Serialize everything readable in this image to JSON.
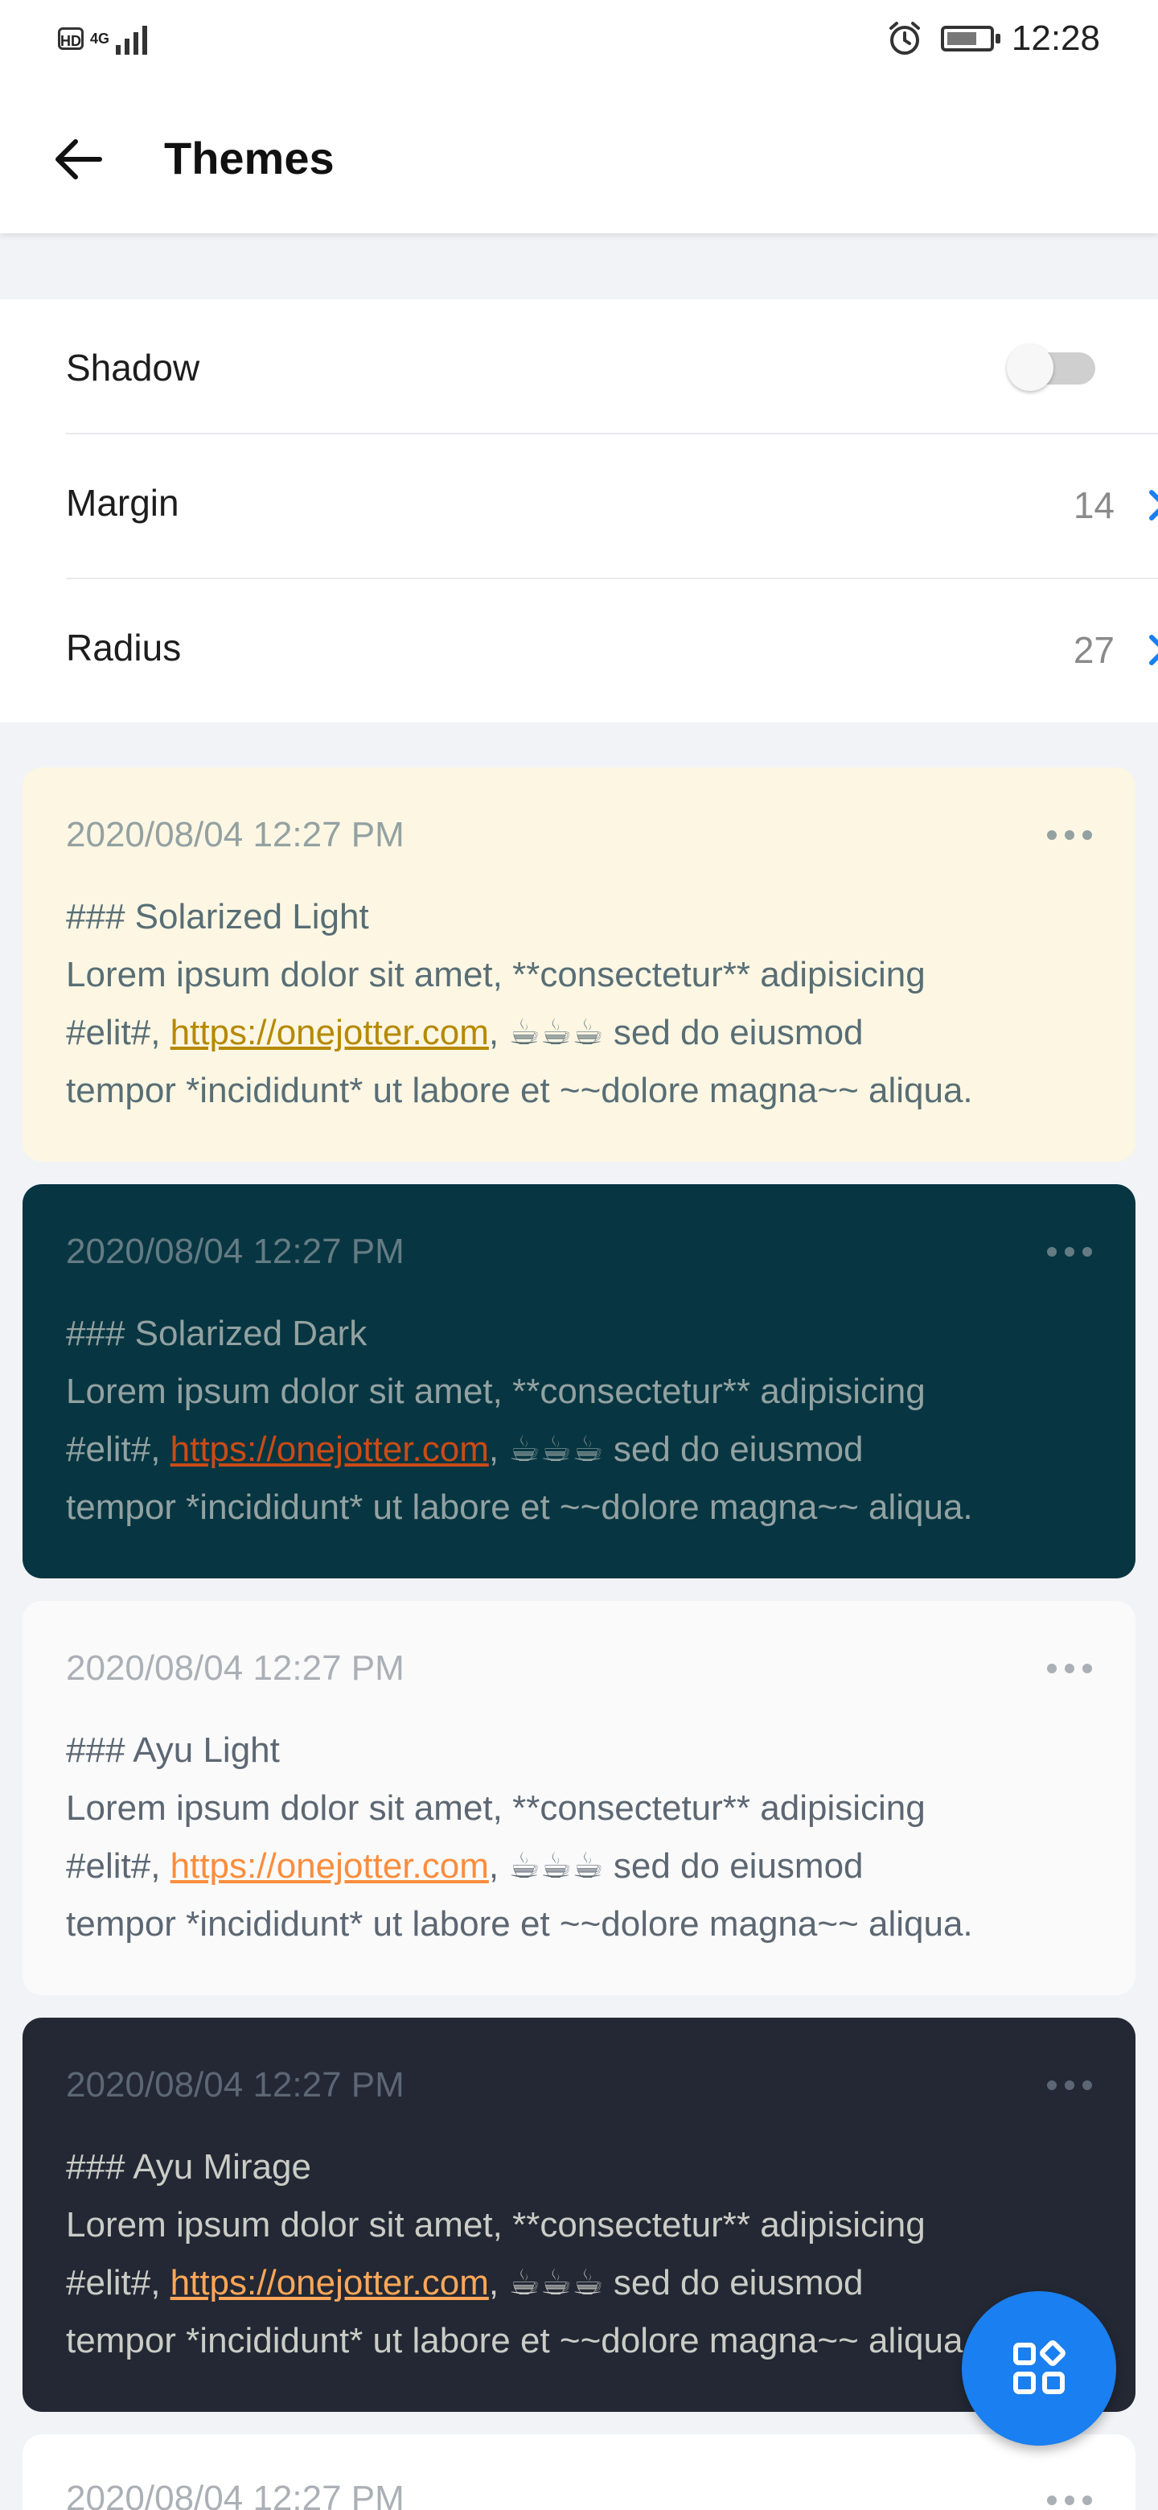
{
  "status_bar": {
    "hd": "HD",
    "network": "4G",
    "time": "12:28"
  },
  "app_bar": {
    "title": "Themes"
  },
  "settings": {
    "shadow": {
      "label": "Shadow",
      "enabled": false
    },
    "margin": {
      "label": "Margin",
      "value": "14"
    },
    "radius": {
      "label": "Radius",
      "value": "27"
    }
  },
  "cards": [
    {
      "date": "2020/08/04 12:27 PM",
      "heading": "### Solarized Light",
      "line1": "Lorem ipsum dolor sit amet, **consectetur** adipisicing",
      "line2_prefix": "#elit#, ",
      "link": "https://onejotter.com",
      "line2_mid": ", ",
      "cups": "☕☕☕",
      "line2_suffix": " sed do eiusmod",
      "line3": "tempor *incididunt* ut labore et ~~dolore magna~~ aliqua.",
      "colors": {
        "bg": "#fdf6e3",
        "text": "#586e75",
        "date": "#93a1a1",
        "link": "#b58900"
      }
    },
    {
      "date": "2020/08/04 12:27 PM",
      "heading": "### Solarized Dark",
      "line1": "Lorem ipsum dolor sit amet, **consectetur** adipisicing",
      "line2_prefix": "#elit#, ",
      "link": "https://onejotter.com",
      "line2_mid": ", ",
      "cups": "☕☕☕",
      "line2_suffix": " sed do eiusmod",
      "line3": "tempor *incididunt* ut labore et ~~dolore magna~~ aliqua.",
      "colors": {
        "bg": "#073642",
        "text": "#93a1a1",
        "date": "#657b83",
        "link": "#cb4b16"
      }
    },
    {
      "date": "2020/08/04 12:27 PM",
      "heading": "### Ayu Light",
      "line1": "Lorem ipsum dolor sit amet, **consectetur** adipisicing",
      "line2_prefix": "#elit#, ",
      "link": "https://onejotter.com",
      "line2_mid": ", ",
      "cups": "☕☕☕",
      "line2_suffix": " sed do eiusmod",
      "line3": "tempor *incididunt* ut labore et ~~dolore magna~~ aliqua.",
      "colors": {
        "bg": "#fafafa",
        "text": "#5c6773",
        "date": "#abb0b6",
        "link": "#fa8d3e"
      }
    },
    {
      "date": "2020/08/04 12:27 PM",
      "heading": "### Ayu Mirage",
      "line1": "Lorem ipsum dolor sit amet, **consectetur** adipisicing",
      "line2_prefix": "#elit#, ",
      "link": "https://onejotter.com",
      "line2_mid": ", ",
      "cups": "☕☕☕",
      "line2_suffix": " sed do eiusmod",
      "line3": "tempor *incididunt* ut labore et ~~dolore magna~~ aliqua.",
      "colors": {
        "bg": "#232834",
        "text": "#cbccc6",
        "date": "#5c6773",
        "link": "#ffa759"
      }
    },
    {
      "date": "2020/08/04 12:27 PM",
      "colors": {
        "bg": "#ffffff",
        "text": "#5c6773",
        "date": "#abb0b6",
        "link": "#1a7ff0"
      }
    }
  ],
  "icons": {
    "back": "arrow-left-icon",
    "chevron": "chevron-right-icon",
    "more": "more-horizontal-icon",
    "fab": "grid-icon"
  },
  "accent_color": "#1a7ff0"
}
